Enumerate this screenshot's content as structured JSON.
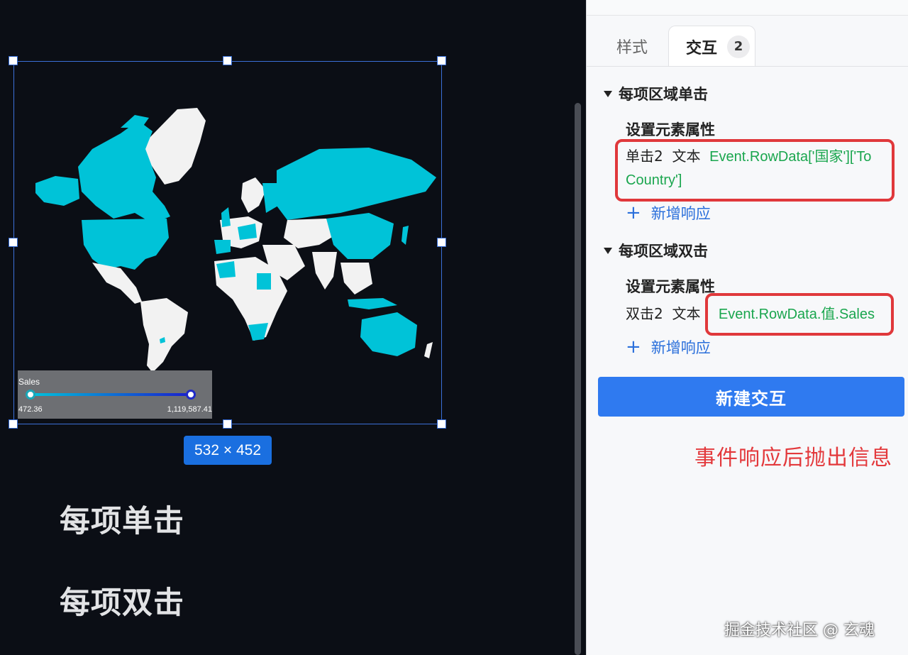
{
  "canvas": {
    "size_badge": "532 × 452",
    "label_single": "每项单击",
    "label_double": "每项双击",
    "map_colors": {
      "highlight": "#00c3d8",
      "other": "#f2f2f2",
      "background": "#0b0e15"
    }
  },
  "legend": {
    "title": "Sales",
    "min": "472.36",
    "max": "1,119,587.41",
    "gradient_start": "#00c3dc",
    "gradient_end": "#1b1ecc"
  },
  "panel": {
    "tabs": [
      {
        "label": "样式"
      },
      {
        "label": "交互",
        "count": "2",
        "active": true
      }
    ],
    "sections": [
      {
        "title": "每项区域单击",
        "subtitle": "设置元素属性",
        "action_name": "单击2",
        "action_type": "文本",
        "code_line1": "Event.RowData['国家']['To",
        "code_line2": "Country']",
        "add_label": "新增响应"
      },
      {
        "title": "每项区域双击",
        "subtitle": "设置元素属性",
        "action_name": "双击2",
        "action_type": "文本",
        "code_line1": "Event.RowData.值.Sales",
        "add_label": "新增响应"
      }
    ],
    "new_button": "新建交互",
    "note": "事件响应后抛出信息",
    "watermark": "掘金技术社区 @ 玄魂",
    "colors": {
      "accent": "#2f7af0",
      "code": "#1aa64e",
      "highlight_box": "#e0383b"
    }
  }
}
